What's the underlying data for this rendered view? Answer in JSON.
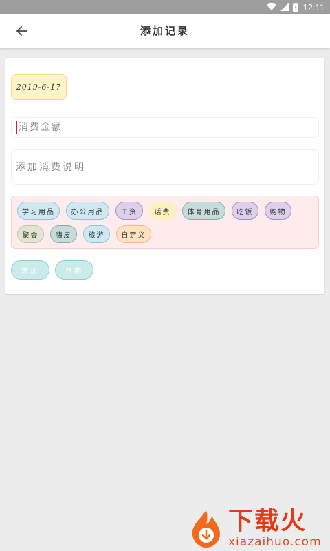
{
  "status_bar": {
    "time": "12:11"
  },
  "app_bar": {
    "title": "添加记录"
  },
  "form": {
    "date": "2019-6-17",
    "amount_placeholder": "消费金额",
    "description_placeholder": "添加消费说明"
  },
  "tags": [
    {
      "label": "学习用品",
      "bg": "#cfe9f3",
      "border": "#8cc4d9"
    },
    {
      "label": "办公用品",
      "bg": "#cfe9f3",
      "border": "#8cc4d9"
    },
    {
      "label": "工资",
      "bg": "#ddd0ea",
      "border": "#a98dc5"
    },
    {
      "label": "话费",
      "bg": "#fff0c0",
      "border": "#fff0c0"
    },
    {
      "label": "体育用品",
      "bg": "#c5dcda",
      "border": "#7fb0aa"
    },
    {
      "label": "吃饭",
      "bg": "#ddd0ea",
      "border": "#a98dc5"
    },
    {
      "label": "购物",
      "bg": "#ddd0ea",
      "border": "#a98dc5"
    },
    {
      "label": "聚会",
      "bg": "#dfe5cf",
      "border": "#bcc8a0"
    },
    {
      "label": "嗨皮",
      "bg": "#c5dcda",
      "border": "#7fb0aa"
    },
    {
      "label": "旅游",
      "bg": "#cfe9f3",
      "border": "#8cc4d9"
    },
    {
      "label": "自定义",
      "bg": "#ffe0c0",
      "border": "#f7b98a"
    }
  ],
  "actions": {
    "add_label": "添加",
    "date_label": "日期"
  },
  "watermark": {
    "big": "下载火",
    "small": "xiazaihuo.com"
  }
}
